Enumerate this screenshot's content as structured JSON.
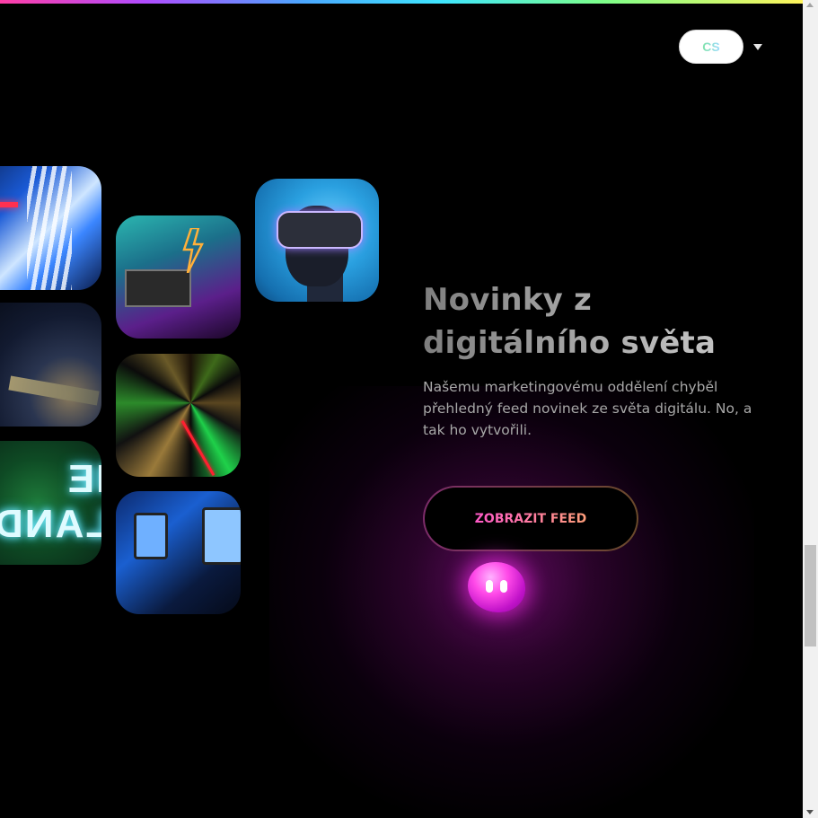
{
  "header": {
    "language_selector": {
      "value": "CS",
      "icon": "chevron-down-icon"
    }
  },
  "gallery": {
    "tiles": [
      {
        "name": "neon-signs-photo"
      },
      {
        "name": "hand-on-device-photo"
      },
      {
        "name": "neon-the-island-sign-photo",
        "text": "THE ISLAND"
      },
      {
        "name": "neon-lightning-studio-photo"
      },
      {
        "name": "abstract-burst-photo"
      },
      {
        "name": "laptop-phone-desk-photo"
      },
      {
        "name": "vr-headset-person-photo"
      }
    ]
  },
  "hero": {
    "title_line1": "Novinky z",
    "title_line2": "digitálního světa",
    "description": "Našemu marketingovému oddělení chyběl přehledný feed novinek ze světa digitálu.  No, a tak ho vytvořili.",
    "cta_label": "ZOBRAZIT FEED"
  },
  "mascot": {
    "name": "pink-blob-mascot"
  },
  "colors": {
    "background": "#000000",
    "accent_pink": "#ff49e8",
    "cta_text": "#ff59c8",
    "text_muted": "#a8a8a8"
  }
}
